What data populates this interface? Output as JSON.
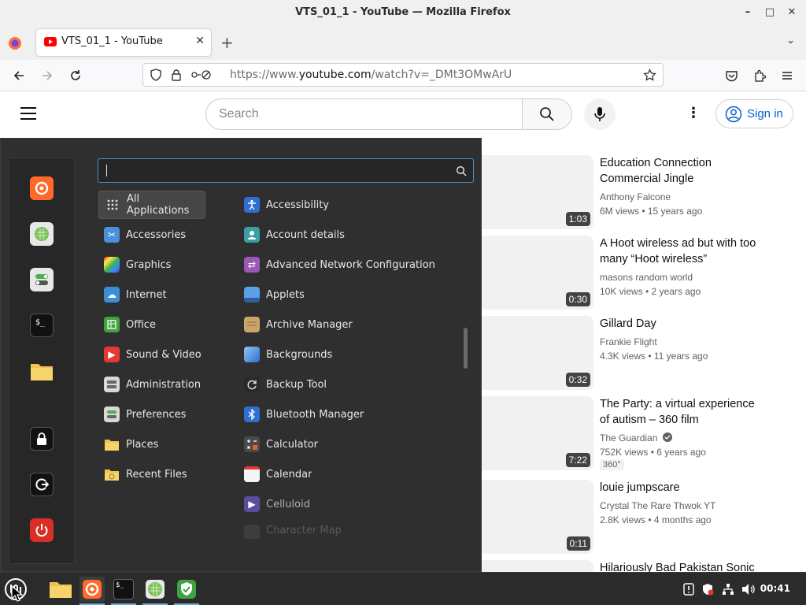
{
  "window": {
    "title": "VTS_01_1 - YouTube — Mozilla Firefox",
    "minimize": "–",
    "maximize": "□",
    "close": "✕"
  },
  "browser": {
    "tab_title": "VTS_01_1 - YouTube",
    "tab_close": "✕",
    "new_tab": "+",
    "tab_list": "⌄",
    "url_prefix": "https://www.",
    "url_domain": "youtube.com",
    "url_suffix": "/watch?v=_DMt3OMwArU"
  },
  "youtube": {
    "search_placeholder": "Search",
    "more": "⋮",
    "signin_label": "Sign in",
    "videos": [
      {
        "title": "Education Connection Commercial Jingle",
        "channel": "Anthony Falcone",
        "meta": "6M views • 15 years ago",
        "duration": "1:03"
      },
      {
        "title": "A Hoot wireless ad but with too many “Hoot wireless”",
        "channel": "masons random world",
        "meta": "10K views • 2 years ago",
        "duration": "0:30"
      },
      {
        "title": "Gillard Day",
        "channel": "Frankie Flight",
        "meta": "4.3K views • 11 years ago",
        "duration": "0:32"
      },
      {
        "title": "The Party: a virtual experience of autism – 360 film",
        "channel": "The Guardian",
        "meta": "752K views • 6 years ago",
        "duration": "7:22",
        "badge": "360°"
      },
      {
        "title": "louie jumpscare",
        "channel": "Crystal The Rare Thwok YT",
        "meta": "2.8K views • 4 months ago",
        "duration": "0:11"
      },
      {
        "title": "Hilariously Bad Pakistan Sonic",
        "channel": "",
        "meta": "",
        "duration": ""
      }
    ]
  },
  "menu": {
    "search_value": "",
    "categories": [
      {
        "label": "All Applications",
        "icon": "grid-icon",
        "color": "#3a3a3a"
      },
      {
        "label": "Accessories",
        "icon": "scissors-icon",
        "color": "#4a90d9"
      },
      {
        "label": "Graphics",
        "icon": "palette-icon",
        "color": "#c44bd6"
      },
      {
        "label": "Internet",
        "icon": "cloud-icon",
        "color": "#3b8fd9"
      },
      {
        "label": "Office",
        "icon": "spreadsheet-icon",
        "color": "#3fa33f"
      },
      {
        "label": "Sound & Video",
        "icon": "play-icon",
        "color": "#e53935"
      },
      {
        "label": "Administration",
        "icon": "admin-icon",
        "color": "#8a8a8a"
      },
      {
        "label": "Preferences",
        "icon": "toggles-icon",
        "color": "#8a8a8a"
      },
      {
        "label": "Places",
        "icon": "folder-icon",
        "color": "#f2c14e"
      },
      {
        "label": "Recent Files",
        "icon": "recent-folder-icon",
        "color": "#f2c14e"
      }
    ],
    "apps": [
      {
        "label": "Accessibility",
        "icon": "accessibility-icon",
        "color": "#2f6fd1"
      },
      {
        "label": "Account details",
        "icon": "account-icon",
        "color": "#3a9ea5"
      },
      {
        "label": "Advanced Network Configuration",
        "icon": "network-icon",
        "color": "#9b59b6"
      },
      {
        "label": "Applets",
        "icon": "applets-icon",
        "color": "#5aa0e6"
      },
      {
        "label": "Archive Manager",
        "icon": "archive-icon",
        "color": "#c9a46b"
      },
      {
        "label": "Backgrounds",
        "icon": "backgrounds-icon",
        "color": "#3b8fd9"
      },
      {
        "label": "Backup Tool",
        "icon": "backup-icon",
        "color": "#4a4a4a"
      },
      {
        "label": "Bluetooth Manager",
        "icon": "bluetooth-icon",
        "color": "#2f6fd1"
      },
      {
        "label": "Calculator",
        "icon": "calculator-icon",
        "color": "#555555"
      },
      {
        "label": "Calendar",
        "icon": "calendar-icon",
        "color": "#f5f5f5"
      },
      {
        "label": "Celluloid",
        "icon": "celluloid-icon",
        "color": "#5b4c9e"
      },
      {
        "label": "Character Map",
        "icon": "charmap-icon",
        "color": "#555555"
      }
    ],
    "favorites": [
      {
        "name": "firefox",
        "color": "#ff6a2b"
      },
      {
        "name": "software-manager",
        "color": "#8fd16a"
      },
      {
        "name": "settings-toggles",
        "color": "#e8e8e8"
      },
      {
        "name": "terminal",
        "color": "#1e1e1e"
      },
      {
        "name": "files",
        "color": "#f2c14e"
      },
      {
        "name": "lock-screen",
        "color": "#1e1e1e"
      },
      {
        "name": "logout",
        "color": "#1e1e1e"
      },
      {
        "name": "shutdown",
        "color": "#d93025"
      }
    ]
  },
  "taskbar": {
    "clock": "00:41"
  }
}
